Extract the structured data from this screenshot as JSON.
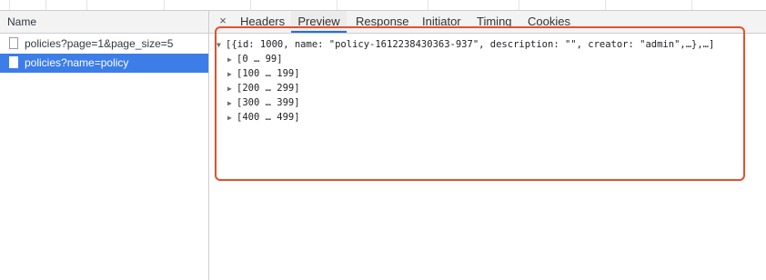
{
  "left_pane": {
    "header": "Name",
    "requests": [
      {
        "label": "policies?page=1&page_size=5",
        "selected": false
      },
      {
        "label": "policies?name=policy",
        "selected": true
      }
    ]
  },
  "detail_tabs": {
    "close_glyph": "×",
    "tabs": [
      {
        "label": "Headers",
        "active": false
      },
      {
        "label": "Preview",
        "active": true
      },
      {
        "label": "Response",
        "active": false
      },
      {
        "label": "Initiator",
        "active": false
      },
      {
        "label": "Timing",
        "active": false
      },
      {
        "label": "Cookies",
        "active": false
      }
    ]
  },
  "preview": {
    "root_summary": "[{id: 1000, name: \"policy-1612238430363-937\", description: \"\", creator: \"admin\",…},…]",
    "groups": [
      "[0 … 99]",
      "[100 … 199]",
      "[200 … 299]",
      "[300 … 399]",
      "[400 … 499]"
    ],
    "expanded_glyph": "▼",
    "collapsed_glyph": "▶"
  },
  "colors": {
    "selection": "#3c7de8",
    "annotation_box": "#e4502d",
    "active_tab_underline": "#1a73e8"
  }
}
